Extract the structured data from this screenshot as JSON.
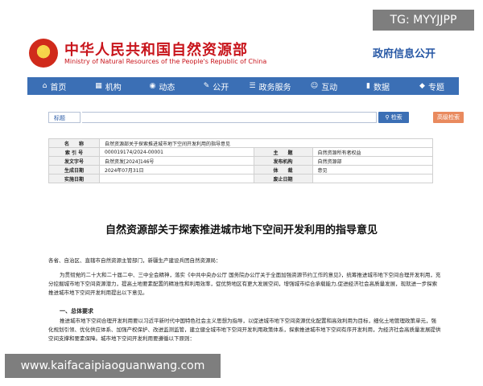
{
  "badge": "TG: MYYJJPP",
  "header": {
    "title": "中华人民共和国自然资源部",
    "subtitle": "Ministry of Natural Resources of the People's Republic of China",
    "right": "政府信息公开"
  },
  "nav": [
    {
      "icon": "home-icon",
      "label": "首页"
    },
    {
      "icon": "org-icon",
      "label": "机构"
    },
    {
      "icon": "news-icon",
      "label": "动态"
    },
    {
      "icon": "public-icon",
      "label": "公开"
    },
    {
      "icon": "service-icon",
      "label": "政务服务"
    },
    {
      "icon": "interact-icon",
      "label": "互动"
    },
    {
      "icon": "data-icon",
      "label": "数据"
    },
    {
      "icon": "topic-icon",
      "label": "专题"
    }
  ],
  "search": {
    "select": "标题",
    "placeholder": "",
    "button": "检索",
    "advanced": "高级检索"
  },
  "meta": {
    "name_label": "名　　称",
    "name": "自然资源部关于探索推进城市地下空间开发利用的指导意见",
    "index_label": "索 引 号",
    "index": "000019174/2024-00001",
    "subject_label": "主　　题",
    "subject": "自然资源所有者权益",
    "docno_label": "发文字号",
    "docno": "自然资发[2024]146号",
    "issuer_label": "发布机构",
    "issuer": "自然资源部",
    "date_label": "生成日期",
    "date": "2024年07月31日",
    "type_label": "体　　裁",
    "type": "意见",
    "effective_label": "实施日期",
    "effective": "",
    "end_label": "废止日期",
    "end": ""
  },
  "doc": {
    "title": "自然资源部关于探索推进城市地下空间开发利用的指导意见",
    "p1": "各省、自治区、直辖市自然资源主管部门，新疆生产建设兵团自然资源局：",
    "p2": "为贯彻党的二十大和二十届二中、三中全会精神，落实《中共中央办公厅 国务院办公厅关于全面加强资源节约工作的意见》，统筹推进城市地下空间合理开发利用，充分挖掘城市地下空间资源潜力，提高土地要素配置的精准性和利用效率，促优势地区有更大发展空间，增强城市综合承载能力,促进经济社会高质量发展，现就进一步探索推进城市地下空间开发利用提出以下意见。",
    "section1": "一、总体要求",
    "p3": "推进城市地下空间合理开发利用要以习近平新时代中国特色社会主义思想为指导，以促进城市地下空间资源优化配置和高效利用为目标，细化土地管理政策单元，强化规划引领、优化供应体系、加强产权保护、改进监测监管，建立健全城市地下空间开发利用政策体系，探索推进城市地下空间有序开发利用，为经济社会高质量发展提供空间支撑和要素保障。城市地下空间开发利用要遵循以下原则："
  },
  "watermark": "www.kaifacaipiaoguanwang.com"
}
